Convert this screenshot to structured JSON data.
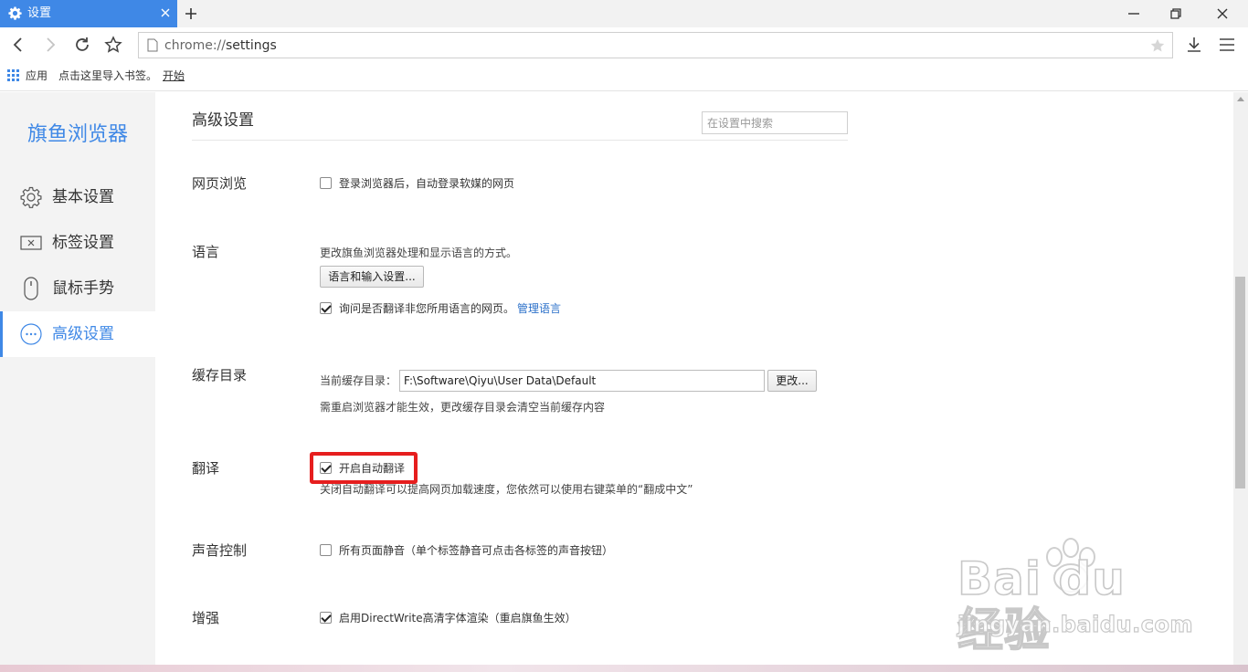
{
  "tab": {
    "title": "设置"
  },
  "address": {
    "scheme": "chrome://",
    "path": "settings"
  },
  "bookmarks": {
    "apps": "应用",
    "import_hint": "点击这里导入书签。",
    "start": "开始"
  },
  "sidebar": {
    "brand": "旗鱼浏览器",
    "items": [
      {
        "label": "基本设置",
        "icon": "gear-icon",
        "active": false
      },
      {
        "label": "标签设置",
        "icon": "tab-icon",
        "active": false
      },
      {
        "label": "鼠标手势",
        "icon": "mouse-icon",
        "active": false
      },
      {
        "label": "高级设置",
        "icon": "more-icon",
        "active": true
      }
    ]
  },
  "main": {
    "title": "高级设置",
    "search_placeholder": "在设置中搜索",
    "browsing": {
      "label": "网页浏览",
      "auto_login": {
        "text": "登录浏览器后，自动登录软媒的网页",
        "checked": false
      }
    },
    "language": {
      "label": "语言",
      "desc": "更改旗鱼浏览器处理和显示语言的方式。",
      "button": "语言和输入设置...",
      "ask_translate": {
        "text": "询问是否翻译非您所用语言的网页。",
        "checked": true
      },
      "manage_link": "管理语言"
    },
    "cache": {
      "label": "缓存目录",
      "current_label": "当前缓存目录：",
      "path": "F:\\Software\\Qiyu\\User Data\\Default",
      "change_button": "更改...",
      "note": "需重启浏览器才能生效，更改缓存目录会清空当前缓存内容"
    },
    "translate": {
      "label": "翻译",
      "auto": {
        "text": "开启自动翻译",
        "checked": true
      },
      "note": "关闭自动翻译可以提高网页加载速度，您依然可以使用右键菜单的“翻成中文”"
    },
    "sound": {
      "label": "声音控制",
      "mute_all": {
        "text": "所有页面静音（单个标签静音可点击各标签的声音按钮）",
        "checked": false
      }
    },
    "enhance": {
      "label": "增强",
      "directwrite": {
        "text": "启用DirectWrite高清字体渲染（重启旗鱼生效）",
        "checked": true
      }
    }
  },
  "watermark": {
    "brand": "Bai du 经验",
    "sub": "jingyan.baidu.com"
  },
  "colors": {
    "accent": "#3f88e6",
    "highlight": "#e61e1e",
    "link": "#2a6fc9"
  }
}
